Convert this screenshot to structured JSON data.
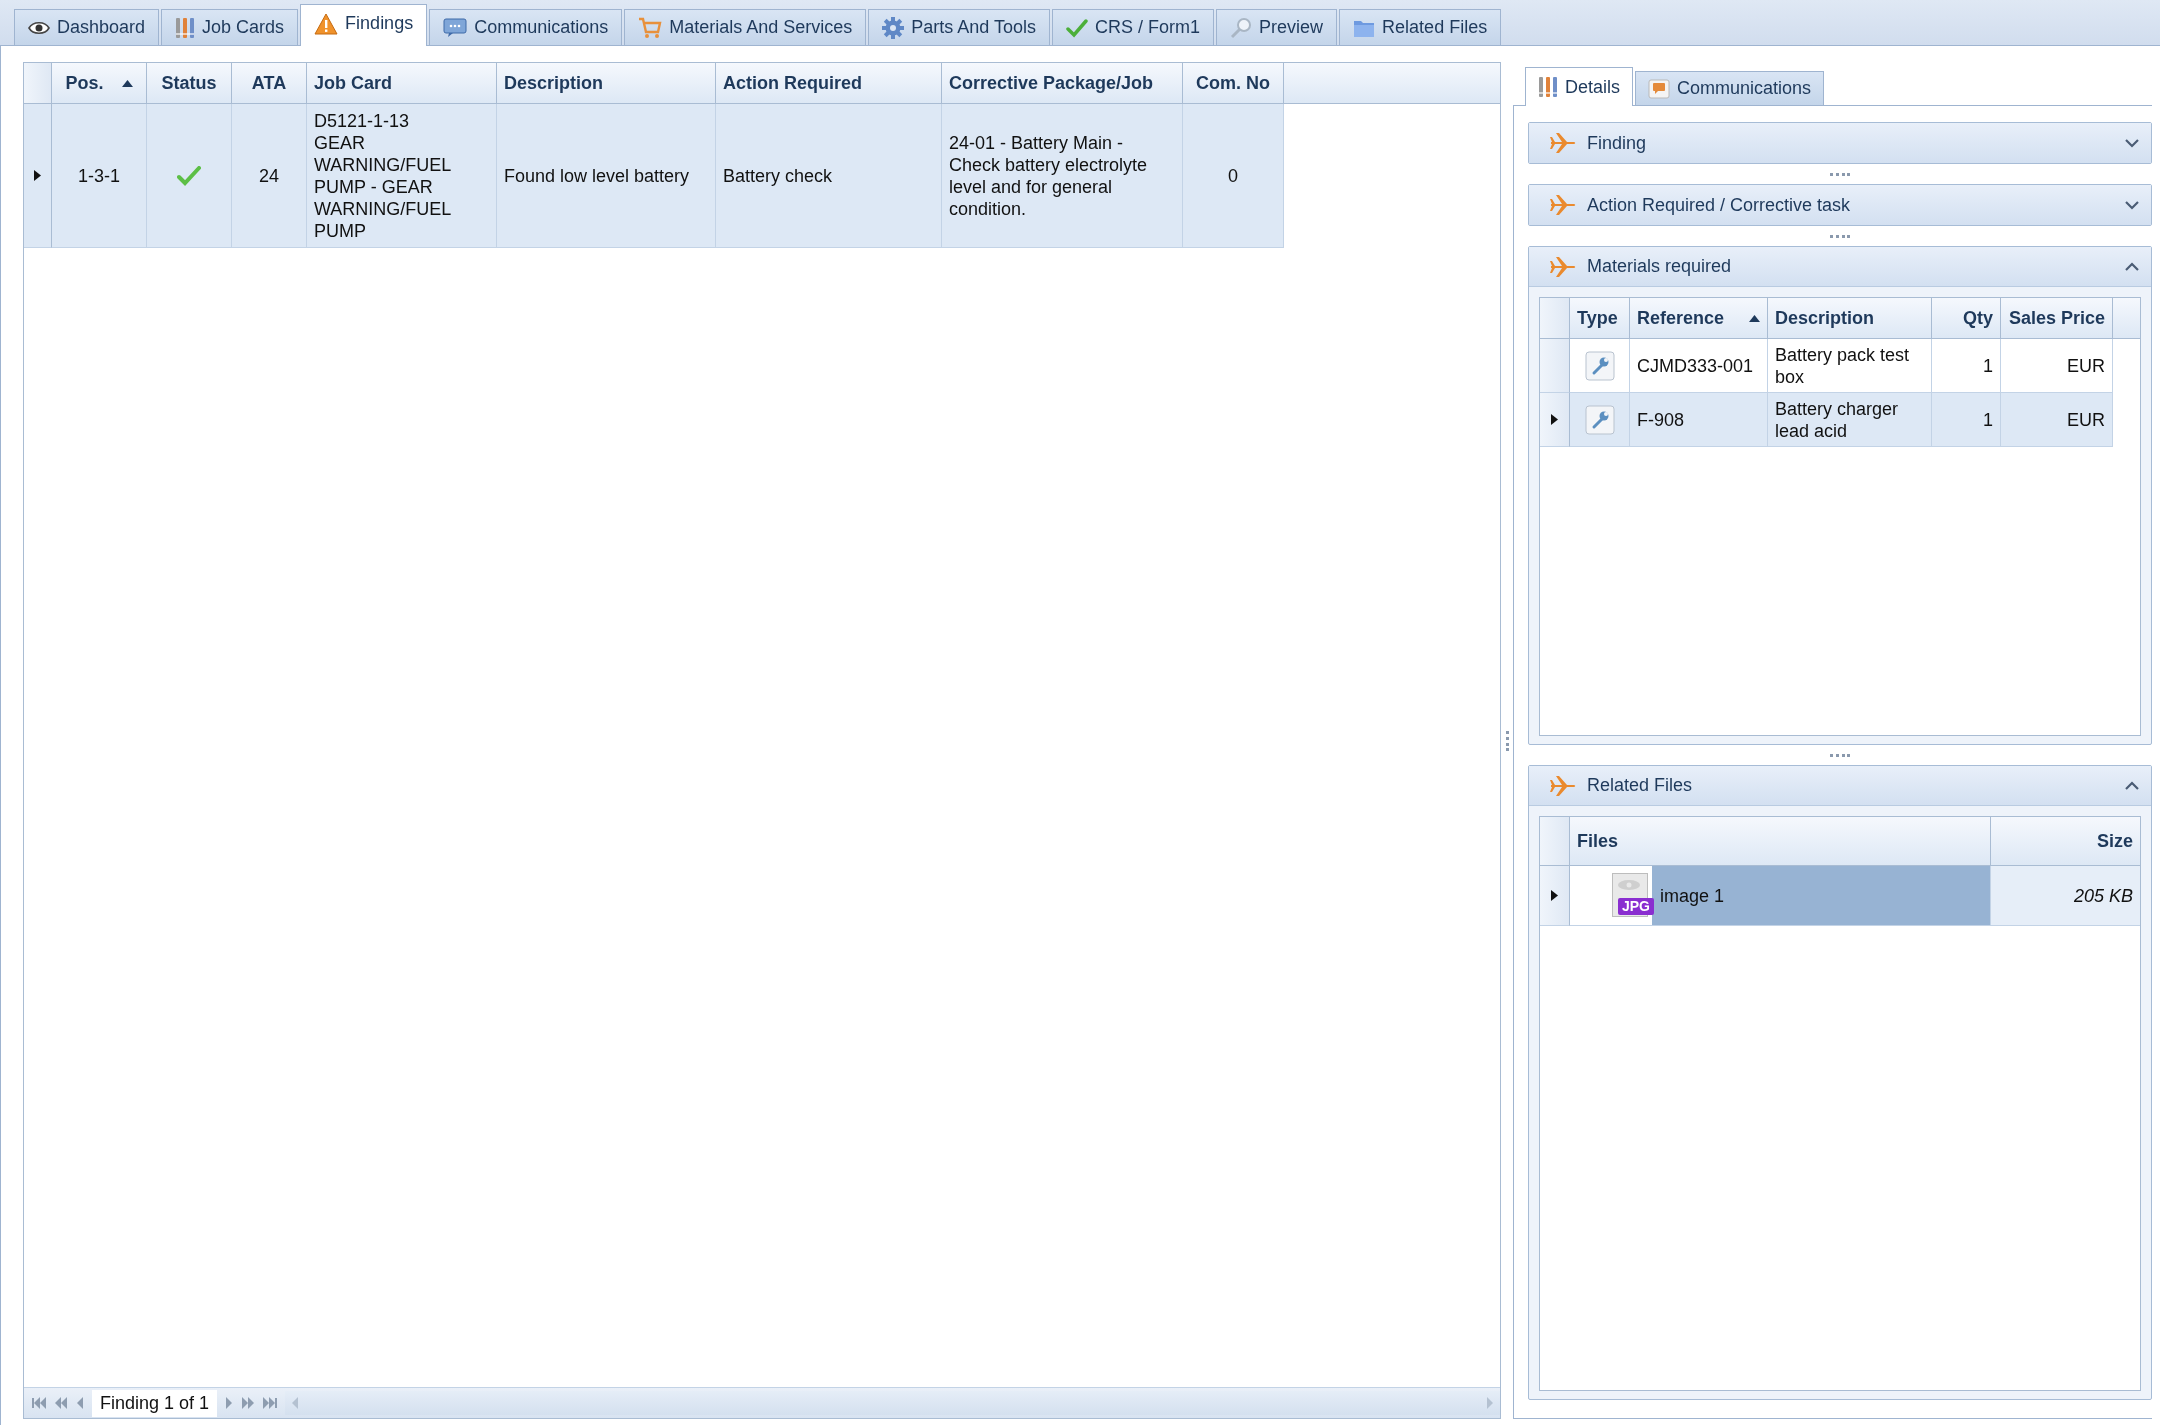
{
  "tabs": [
    {
      "label": "Dashboard",
      "selected": false
    },
    {
      "label": "Job Cards",
      "selected": false
    },
    {
      "label": "Findings",
      "selected": true
    },
    {
      "label": "Communications",
      "selected": false
    },
    {
      "label": "Materials And Services",
      "selected": false
    },
    {
      "label": "Parts And Tools",
      "selected": false
    },
    {
      "label": "CRS / Form1",
      "selected": false
    },
    {
      "label": "Preview",
      "selected": false
    },
    {
      "label": "Related Files",
      "selected": false
    }
  ],
  "findings": {
    "columns": [
      {
        "label": "Pos.",
        "sorted_ascending": true
      },
      {
        "label": "Status",
        "sorted_ascending": false
      },
      {
        "label": "ATA",
        "sorted_ascending": false
      },
      {
        "label": "Job Card",
        "sorted_ascending": false
      },
      {
        "label": "Description",
        "sorted_ascending": false
      },
      {
        "label": "Action Required",
        "sorted_ascending": false
      },
      {
        "label": "Corrective Package/Job",
        "sorted_ascending": false
      },
      {
        "label": "Com. No",
        "sorted_ascending": false
      }
    ],
    "rows": [
      {
        "current": true,
        "position": "1-3-1",
        "completed": true,
        "ata": "24",
        "job_card": "D5121-1-13\nGEAR WARNING/FUEL PUMP - GEAR WARNING/FUEL PUMP",
        "description": "Found low level battery",
        "action_required": "Battery check",
        "corrective_package": "24-01 - Battery Main - Check battery electrolyte level and for general condition.",
        "com_no": "0"
      }
    ],
    "navigator": "Finding 1 of 1"
  },
  "details": {
    "tabs": [
      {
        "label": "Details",
        "selected": true
      },
      {
        "label": "Communications",
        "selected": false
      }
    ],
    "sections": [
      {
        "kind": "collapsed",
        "title": "Finding",
        "expanded": false
      },
      {
        "kind": "collapsed",
        "title": "Action Required / Corrective task",
        "expanded": false
      },
      {
        "kind": "materials",
        "title": "Materials required",
        "expanded": true,
        "columns": [
          {
            "label": "Type",
            "sorted_ascending": false
          },
          {
            "label": "Reference",
            "sorted_ascending": true
          },
          {
            "label": "Description",
            "sorted_ascending": false
          },
          {
            "label": "Qty",
            "sorted_ascending": false
          },
          {
            "label": "Sales Price",
            "sorted_ascending": false
          }
        ],
        "rows": [
          {
            "current": false,
            "reference": "CJMD333-001",
            "description": "Battery pack test box",
            "qty": "1",
            "sales_price": "EUR"
          },
          {
            "current": true,
            "reference": "F-908",
            "description": "Battery charger lead acid",
            "qty": "1",
            "sales_price": "EUR"
          }
        ]
      },
      {
        "kind": "files",
        "title": "Related Files",
        "expanded": true,
        "columns": [
          {
            "label": "Files"
          },
          {
            "label": "Size"
          }
        ],
        "rows": [
          {
            "current": true,
            "selected": true,
            "badge": "JPG",
            "name": "image 1",
            "size": "205 KB"
          }
        ]
      }
    ]
  }
}
